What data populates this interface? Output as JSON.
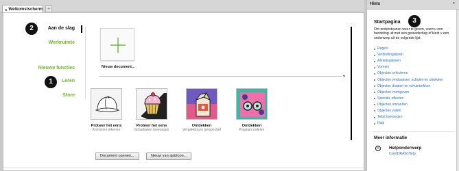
{
  "tabs": {
    "active_label": "Welkomstscherm",
    "add_label": "+"
  },
  "nav": {
    "items": [
      {
        "label": "Aan de slag",
        "active": true
      },
      {
        "label": "Werkruimte",
        "active": false
      },
      {
        "label": "Nieuwe functies",
        "active": false
      },
      {
        "label": "Leren",
        "active": false
      },
      {
        "label": "Store",
        "active": false
      }
    ]
  },
  "callouts": [
    "1",
    "2",
    "3"
  ],
  "new_document": {
    "label": "Nieuw document..."
  },
  "cards": [
    {
      "title": "Probeer het eens",
      "subtitle": "Krommen tekenen",
      "icon": "cap-icon"
    },
    {
      "title": "Probeer het eens",
      "subtitle": "Schaduwen toevoegen",
      "icon": "cupcake-icon"
    },
    {
      "title": "Ontdekken",
      "subtitle": "Verpakking in perspectief",
      "icon": "milk-carton-icon"
    },
    {
      "title": "Ontdekken",
      "subtitle": "Pagina's indelen",
      "icon": "glasses-icon"
    }
  ],
  "buttons": {
    "open_document": "Document openen...",
    "new_from_template": "Nieuw van sjabloon..."
  },
  "hints": {
    "header": "Hints",
    "collapse_label": "»",
    "title": "Startpagina",
    "intro": "Om ondersteunen weer te geven, voert u een handeling uit met een gereedschap of kiest u een onderwerp uit de volgende lijst.",
    "topics": [
      "Regels",
      "Verbindingslijnen",
      "Afmetingslijnen",
      "Vormen",
      "Objecten selecteren",
      "Objecten verplaatsen, schalen en uitrekken",
      "Objecten draaien en schuintrekken",
      "Objecten vormgeven",
      "Speciale effecten",
      "Objecten omranden",
      "Objecten vullen",
      "Tekst toevoegen",
      "Hulp"
    ],
    "more_info_title": "Meer informatie",
    "help_icon": "i",
    "help_title": "Helponderwerp",
    "help_sub": "CorelDRAW Help"
  },
  "colors": {
    "nav_green": "#66bb22",
    "link_blue": "#2a6ec6"
  }
}
